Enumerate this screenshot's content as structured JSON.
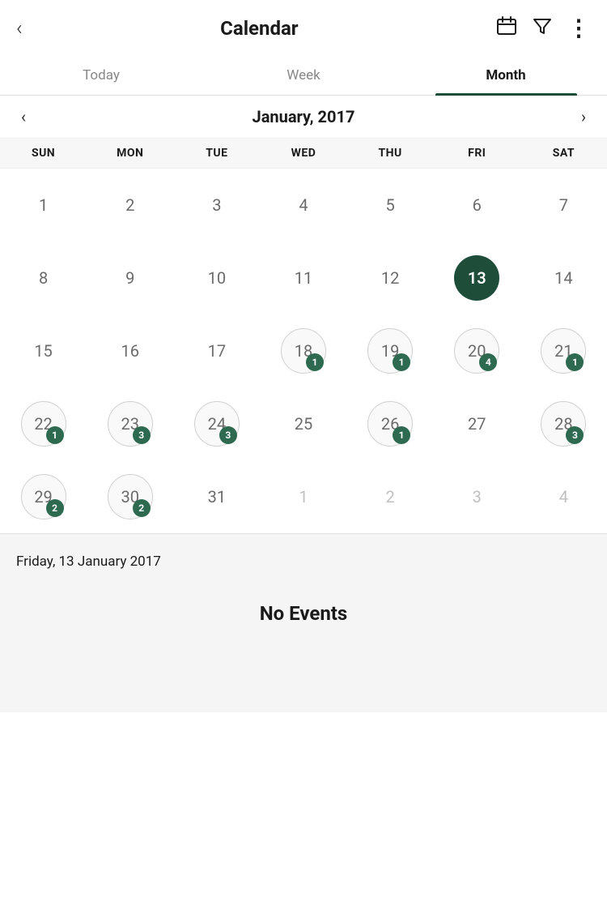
{
  "header": {
    "back_label": "‹",
    "title": "Calendar",
    "calendar_icon": "📅",
    "filter_icon": "⛉",
    "more_icon": "⋮"
  },
  "tabs": [
    {
      "id": "today",
      "label": "Today",
      "active": false
    },
    {
      "id": "week",
      "label": "Week",
      "active": false
    },
    {
      "id": "month",
      "label": "Month",
      "active": true
    }
  ],
  "month_nav": {
    "prev_arrow": "‹",
    "next_arrow": "›",
    "title": "January, 2017"
  },
  "day_headers": [
    "SUN",
    "MON",
    "TUE",
    "WED",
    "THU",
    "FRI",
    "SAT"
  ],
  "weeks": [
    [
      {
        "num": "1",
        "faded": false,
        "today": false,
        "events": 0
      },
      {
        "num": "2",
        "faded": false,
        "today": false,
        "events": 0
      },
      {
        "num": "3",
        "faded": false,
        "today": false,
        "events": 0
      },
      {
        "num": "4",
        "faded": false,
        "today": false,
        "events": 0
      },
      {
        "num": "5",
        "faded": false,
        "today": false,
        "events": 0
      },
      {
        "num": "6",
        "faded": false,
        "today": false,
        "events": 0
      },
      {
        "num": "7",
        "faded": false,
        "today": false,
        "events": 0
      }
    ],
    [
      {
        "num": "8",
        "faded": false,
        "today": false,
        "events": 0
      },
      {
        "num": "9",
        "faded": false,
        "today": false,
        "events": 0
      },
      {
        "num": "10",
        "faded": false,
        "today": false,
        "events": 0
      },
      {
        "num": "11",
        "faded": false,
        "today": false,
        "events": 0
      },
      {
        "num": "12",
        "faded": false,
        "today": false,
        "events": 0
      },
      {
        "num": "13",
        "faded": false,
        "today": true,
        "events": 0
      },
      {
        "num": "14",
        "faded": false,
        "today": false,
        "events": 0
      }
    ],
    [
      {
        "num": "15",
        "faded": false,
        "today": false,
        "events": 0
      },
      {
        "num": "16",
        "faded": false,
        "today": false,
        "events": 0
      },
      {
        "num": "17",
        "faded": false,
        "today": false,
        "events": 0
      },
      {
        "num": "18",
        "faded": false,
        "today": false,
        "events": 1
      },
      {
        "num": "19",
        "faded": false,
        "today": false,
        "events": 1
      },
      {
        "num": "20",
        "faded": false,
        "today": false,
        "events": 4
      },
      {
        "num": "21",
        "faded": false,
        "today": false,
        "events": 1
      }
    ],
    [
      {
        "num": "22",
        "faded": false,
        "today": false,
        "events": 1
      },
      {
        "num": "23",
        "faded": false,
        "today": false,
        "events": 3
      },
      {
        "num": "24",
        "faded": false,
        "today": false,
        "events": 3
      },
      {
        "num": "25",
        "faded": false,
        "today": false,
        "events": 0
      },
      {
        "num": "26",
        "faded": false,
        "today": false,
        "events": 1
      },
      {
        "num": "27",
        "faded": false,
        "today": false,
        "events": 0
      },
      {
        "num": "28",
        "faded": false,
        "today": false,
        "events": 3
      }
    ],
    [
      {
        "num": "29",
        "faded": false,
        "today": false,
        "events": 2
      },
      {
        "num": "30",
        "faded": false,
        "today": false,
        "events": 2
      },
      {
        "num": "31",
        "faded": false,
        "today": false,
        "events": 0
      },
      {
        "num": "1",
        "faded": true,
        "today": false,
        "events": 0
      },
      {
        "num": "2",
        "faded": true,
        "today": false,
        "events": 0
      },
      {
        "num": "3",
        "faded": true,
        "today": false,
        "events": 0
      },
      {
        "num": "4",
        "faded": true,
        "today": false,
        "events": 0
      }
    ]
  ],
  "selected_date": {
    "label": "Friday, 13 January 2017",
    "no_events": "No Events"
  }
}
